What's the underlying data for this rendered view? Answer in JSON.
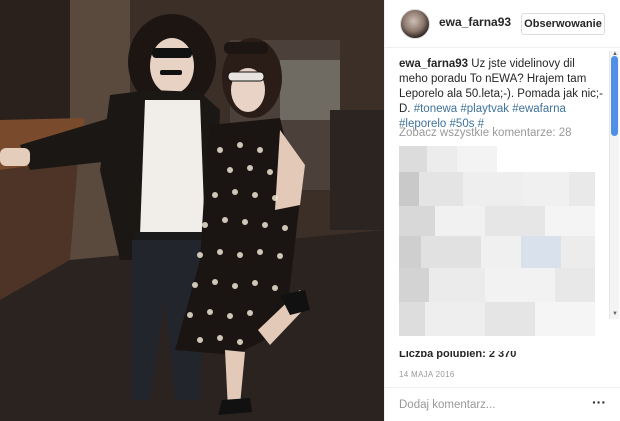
{
  "post": {
    "username": "ewa_farna93",
    "follow_label": "Obserwowanie",
    "caption_user": "ewa_farna93",
    "caption_text": " Uz jste videlinovy dil meho poradu To nEWA? Hrajem tam Leporelo ala 50.leta;-). Pomada jak nic;-D. ",
    "hashtags": [
      "#tonewa",
      "#playtvak",
      "#ewafarna",
      "#leporelo",
      "#50s",
      "#"
    ],
    "view_all_comments": "Zobacz wszystkie komentarze: 28",
    "likes_partial": "Liczba polubień: 2 370",
    "date": "14 MAJA 2016",
    "comment_placeholder": "Dodaj komentarz...",
    "more_icon": "more-options-icon"
  },
  "colors": {
    "hashtag": "#3f729b",
    "muted": "#999999",
    "scroll_thumb": "#4f8fe6"
  }
}
